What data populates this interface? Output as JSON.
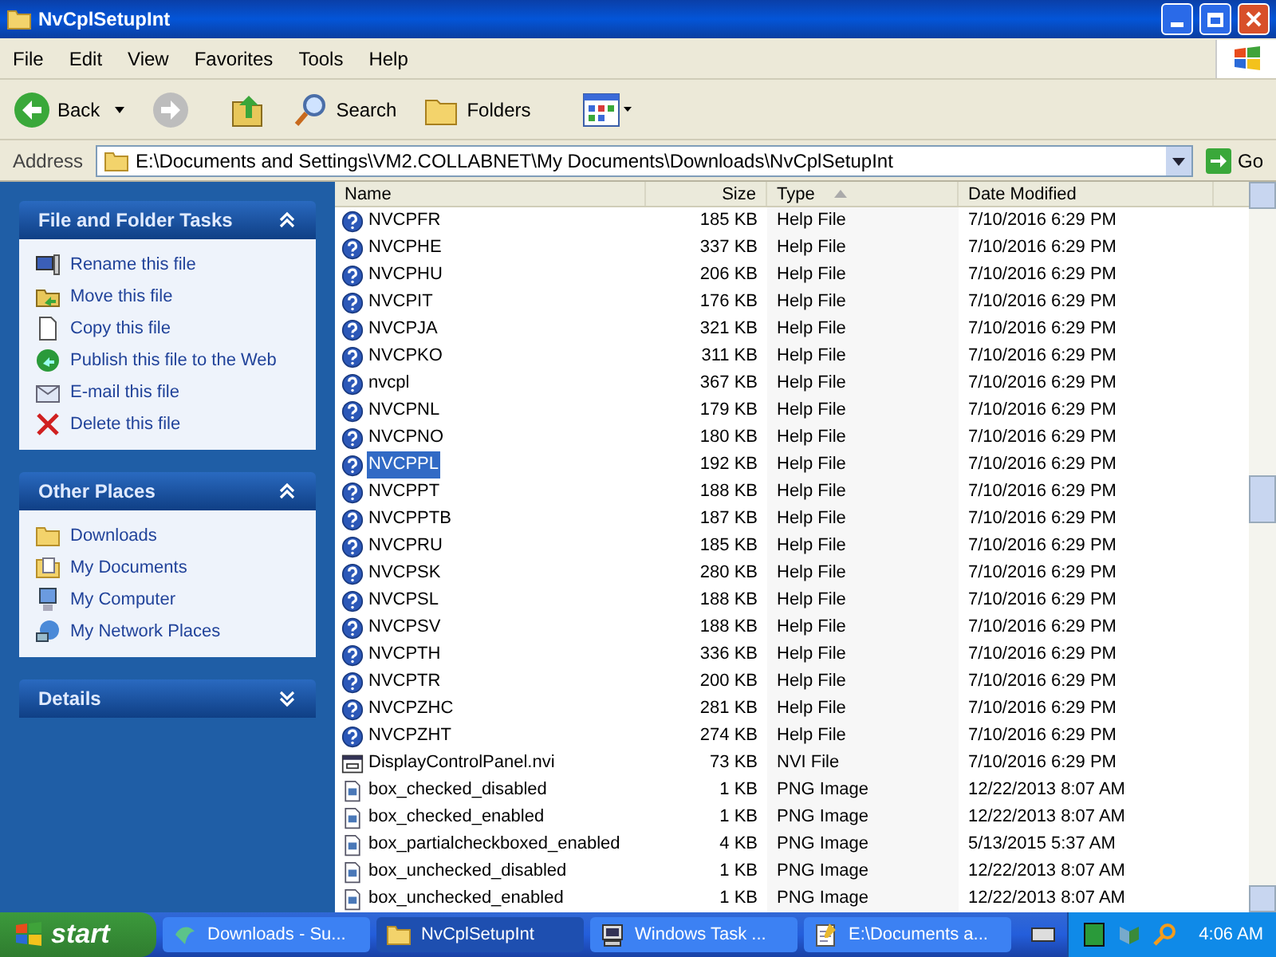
{
  "window": {
    "title": "NvCplSetupInt"
  },
  "menu": [
    "File",
    "Edit",
    "View",
    "Favorites",
    "Tools",
    "Help"
  ],
  "toolbar": {
    "back": "Back",
    "search": "Search",
    "folders": "Folders"
  },
  "address": {
    "label": "Address",
    "value": "E:\\Documents and Settings\\VM2.COLLABNET\\My Documents\\Downloads\\NvCplSetupInt",
    "go": "Go"
  },
  "panels": [
    {
      "title": "File and Folder Tasks",
      "expanded": true,
      "items": [
        {
          "label": "Rename this file",
          "kind": "rename"
        },
        {
          "label": "Move this file",
          "kind": "move"
        },
        {
          "label": "Copy this file",
          "kind": "copy"
        },
        {
          "label": "Publish this file to the Web",
          "kind": "publish"
        },
        {
          "label": "E-mail this file",
          "kind": "email"
        },
        {
          "label": "Delete this file",
          "kind": "delete"
        }
      ]
    },
    {
      "title": "Other Places",
      "expanded": true,
      "items": [
        {
          "label": "Downloads",
          "kind": "folder"
        },
        {
          "label": "My Documents",
          "kind": "documents"
        },
        {
          "label": "My Computer",
          "kind": "computer"
        },
        {
          "label": "My Network Places",
          "kind": "network"
        }
      ]
    },
    {
      "title": "Details",
      "expanded": false
    }
  ],
  "table": {
    "columns": [
      "Name",
      "Size",
      "Type",
      "Date Modified"
    ],
    "rows": [
      {
        "name": "NVCPFR",
        "size": "185 KB",
        "type": "Help File",
        "date": "7/10/2016 6:29 PM",
        "kind": "help",
        "selected": false
      },
      {
        "name": "NVCPHE",
        "size": "337 KB",
        "type": "Help File",
        "date": "7/10/2016 6:29 PM",
        "kind": "help",
        "selected": false
      },
      {
        "name": "NVCPHU",
        "size": "206 KB",
        "type": "Help File",
        "date": "7/10/2016 6:29 PM",
        "kind": "help",
        "selected": false
      },
      {
        "name": "NVCPIT",
        "size": "176 KB",
        "type": "Help File",
        "date": "7/10/2016 6:29 PM",
        "kind": "help",
        "selected": false
      },
      {
        "name": "NVCPJA",
        "size": "321 KB",
        "type": "Help File",
        "date": "7/10/2016 6:29 PM",
        "kind": "help",
        "selected": false
      },
      {
        "name": "NVCPKO",
        "size": "311 KB",
        "type": "Help File",
        "date": "7/10/2016 6:29 PM",
        "kind": "help",
        "selected": false
      },
      {
        "name": "nvcpl",
        "size": "367 KB",
        "type": "Help File",
        "date": "7/10/2016 6:29 PM",
        "kind": "help",
        "selected": false
      },
      {
        "name": "NVCPNL",
        "size": "179 KB",
        "type": "Help File",
        "date": "7/10/2016 6:29 PM",
        "kind": "help",
        "selected": false
      },
      {
        "name": "NVCPNO",
        "size": "180 KB",
        "type": "Help File",
        "date": "7/10/2016 6:29 PM",
        "kind": "help",
        "selected": false
      },
      {
        "name": "NVCPPL",
        "size": "192 KB",
        "type": "Help File",
        "date": "7/10/2016 6:29 PM",
        "kind": "help",
        "selected": true
      },
      {
        "name": "NVCPPT",
        "size": "188 KB",
        "type": "Help File",
        "date": "7/10/2016 6:29 PM",
        "kind": "help",
        "selected": false
      },
      {
        "name": "NVCPPTB",
        "size": "187 KB",
        "type": "Help File",
        "date": "7/10/2016 6:29 PM",
        "kind": "help",
        "selected": false
      },
      {
        "name": "NVCPRU",
        "size": "185 KB",
        "type": "Help File",
        "date": "7/10/2016 6:29 PM",
        "kind": "help",
        "selected": false
      },
      {
        "name": "NVCPSK",
        "size": "280 KB",
        "type": "Help File",
        "date": "7/10/2016 6:29 PM",
        "kind": "help",
        "selected": false
      },
      {
        "name": "NVCPSL",
        "size": "188 KB",
        "type": "Help File",
        "date": "7/10/2016 6:29 PM",
        "kind": "help",
        "selected": false
      },
      {
        "name": "NVCPSV",
        "size": "188 KB",
        "type": "Help File",
        "date": "7/10/2016 6:29 PM",
        "kind": "help",
        "selected": false
      },
      {
        "name": "NVCPTH",
        "size": "336 KB",
        "type": "Help File",
        "date": "7/10/2016 6:29 PM",
        "kind": "help",
        "selected": false
      },
      {
        "name": "NVCPTR",
        "size": "200 KB",
        "type": "Help File",
        "date": "7/10/2016 6:29 PM",
        "kind": "help",
        "selected": false
      },
      {
        "name": "NVCPZHC",
        "size": "281 KB",
        "type": "Help File",
        "date": "7/10/2016 6:29 PM",
        "kind": "help",
        "selected": false
      },
      {
        "name": "NVCPZHT",
        "size": "274 KB",
        "type": "Help File",
        "date": "7/10/2016 6:29 PM",
        "kind": "help",
        "selected": false
      },
      {
        "name": "DisplayControlPanel.nvi",
        "size": "73 KB",
        "type": "NVI File",
        "date": "7/10/2016 6:29 PM",
        "kind": "nvi",
        "selected": false
      },
      {
        "name": "box_checked_disabled",
        "size": "1 KB",
        "type": "PNG Image",
        "date": "12/22/2013 8:07 AM",
        "kind": "image",
        "selected": false
      },
      {
        "name": "box_checked_enabled",
        "size": "1 KB",
        "type": "PNG Image",
        "date": "12/22/2013 8:07 AM",
        "kind": "image",
        "selected": false
      },
      {
        "name": "box_partialcheckboxed_enabled",
        "size": "4 KB",
        "type": "PNG Image",
        "date": "5/13/2015 5:37 AM",
        "kind": "image",
        "selected": false
      },
      {
        "name": "box_unchecked_disabled",
        "size": "1 KB",
        "type": "PNG Image",
        "date": "12/22/2013 8:07 AM",
        "kind": "image",
        "selected": false
      },
      {
        "name": "box_unchecked_enabled",
        "size": "1 KB",
        "type": "PNG Image",
        "date": "12/22/2013 8:07 AM",
        "kind": "image",
        "selected": false
      }
    ]
  },
  "taskbar": {
    "start": "start",
    "tasks": [
      {
        "label": "Downloads - Su...",
        "kind": "browser",
        "selected": false
      },
      {
        "label": "NvCplSetupInt",
        "kind": "folder",
        "selected": true
      },
      {
        "label": "Windows Task ...",
        "kind": "taskmgr",
        "selected": false
      },
      {
        "label": "E:\\Documents a...",
        "kind": "notepad",
        "selected": false
      }
    ],
    "clock": "4:06 AM"
  }
}
